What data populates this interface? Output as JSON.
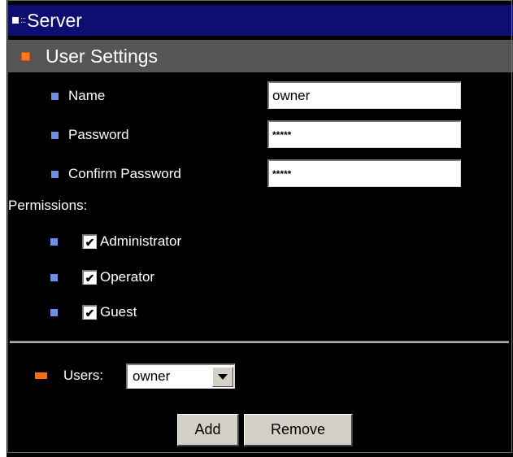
{
  "window": {
    "title": "Server"
  },
  "section": {
    "title": "User Settings"
  },
  "fields": {
    "name": {
      "label": "Name",
      "value": "owner"
    },
    "password": {
      "label": "Password",
      "value": "*****"
    },
    "confirm": {
      "label": "Confirm Password",
      "value": "*****"
    }
  },
  "permissions": {
    "label": "Permissions:",
    "items": [
      {
        "label": "Administrator",
        "checked": true
      },
      {
        "label": "Operator",
        "checked": true
      },
      {
        "label": "Guest",
        "checked": true
      }
    ]
  },
  "users": {
    "label": "Users:",
    "selected": "owner"
  },
  "buttons": {
    "add": "Add",
    "remove": "Remove"
  },
  "colors": {
    "titlebar": "#0e0e72",
    "section_header": "#555555",
    "accent_orange": "#ff7a1a",
    "bullet_blue": "#6e8fe6",
    "background": "#000000"
  }
}
